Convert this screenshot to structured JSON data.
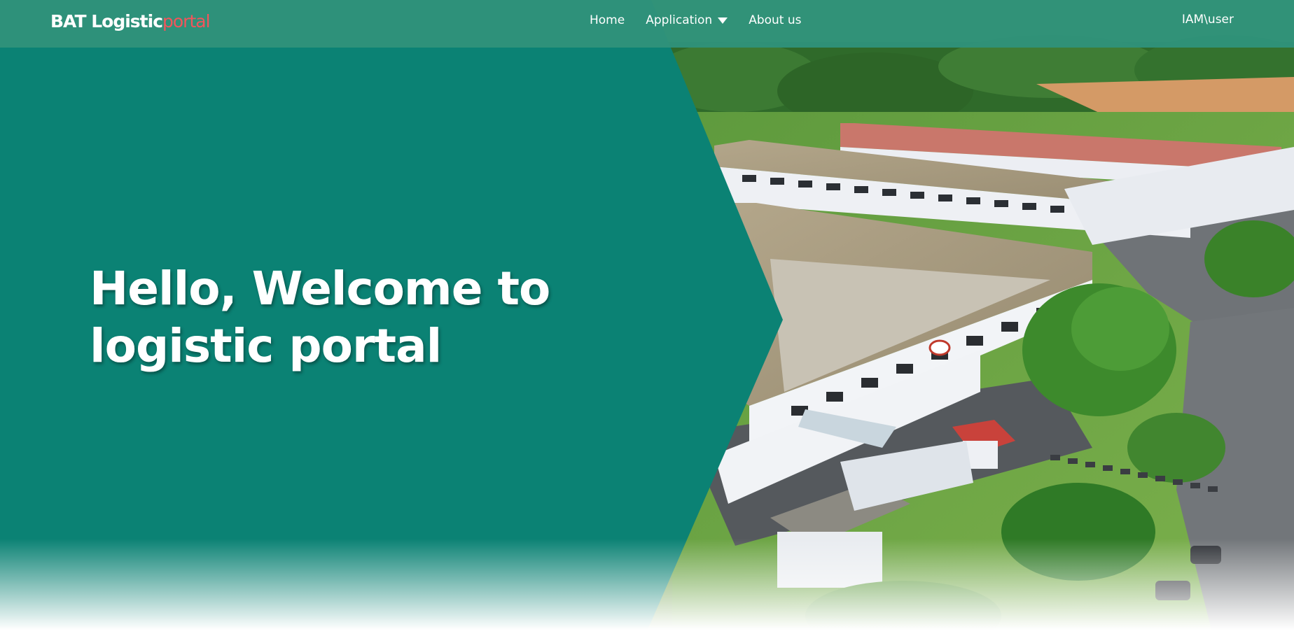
{
  "navbar": {
    "brand_main": "BAT Logistic",
    "brand_accent": "portal",
    "links": [
      {
        "label": "Home"
      },
      {
        "label": "Application",
        "icon": "chevron-down-icon"
      },
      {
        "label": "About us"
      }
    ],
    "user": "IAM\\user"
  },
  "hero": {
    "heading_line1": "Hello, Welcome to",
    "heading_line2": "logistic portal",
    "image": "aerial-factory-photo"
  },
  "colors": {
    "navbar_bg": "#2f927a",
    "hero_green": "#0b8274",
    "brand_accent": "#f2555b",
    "text": "#ffffff"
  }
}
